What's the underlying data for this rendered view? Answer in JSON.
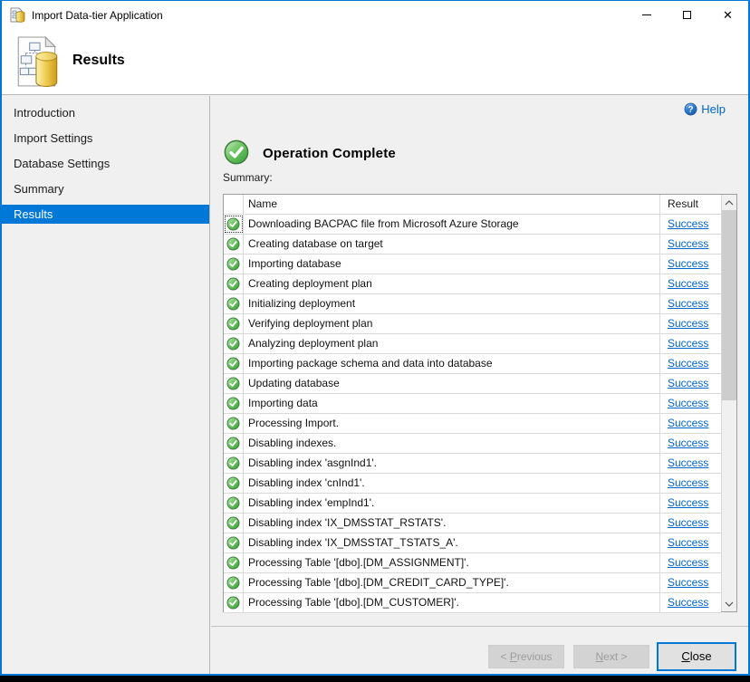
{
  "window": {
    "title": "Import Data-tier Application",
    "close_glyph": "✕"
  },
  "header": {
    "title": "Results"
  },
  "sidebar": {
    "selected_index": 4,
    "items": [
      {
        "label": "Introduction"
      },
      {
        "label": "Import Settings"
      },
      {
        "label": "Database Settings"
      },
      {
        "label": "Summary"
      },
      {
        "label": "Results"
      }
    ]
  },
  "content": {
    "help_label": "Help",
    "status_heading": "Operation Complete",
    "summary_label": "Summary:",
    "table": {
      "columns": {
        "name": "Name",
        "result": "Result"
      },
      "rows": [
        {
          "name": "Downloading BACPAC file from Microsoft Azure Storage",
          "result": "Success"
        },
        {
          "name": "Creating database on target",
          "result": "Success"
        },
        {
          "name": "Importing database",
          "result": "Success"
        },
        {
          "name": "Creating deployment plan",
          "result": "Success"
        },
        {
          "name": "Initializing deployment",
          "result": "Success"
        },
        {
          "name": "Verifying deployment plan",
          "result": "Success"
        },
        {
          "name": "Analyzing deployment plan",
          "result": "Success"
        },
        {
          "name": "Importing package schema and data into database",
          "result": "Success"
        },
        {
          "name": "Updating database",
          "result": "Success"
        },
        {
          "name": "Importing data",
          "result": "Success"
        },
        {
          "name": "Processing Import.",
          "result": "Success"
        },
        {
          "name": "Disabling indexes.",
          "result": "Success"
        },
        {
          "name": "Disabling index 'asgnInd1'.",
          "result": "Success"
        },
        {
          "name": "Disabling index 'cnInd1'.",
          "result": "Success"
        },
        {
          "name": "Disabling index 'empInd1'.",
          "result": "Success"
        },
        {
          "name": "Disabling index 'IX_DMSSTAT_RSTATS'.",
          "result": "Success"
        },
        {
          "name": "Disabling index 'IX_DMSSTAT_TSTATS_A'.",
          "result": "Success"
        },
        {
          "name": "Processing Table '[dbo].[DM_ASSIGNMENT]'.",
          "result": "Success"
        },
        {
          "name": "Processing Table '[dbo].[DM_CREDIT_CARD_TYPE]'.",
          "result": "Success"
        },
        {
          "name": "Processing Table '[dbo].[DM_CUSTOMER]'.",
          "result": "Success"
        }
      ]
    }
  },
  "footer": {
    "previous": {
      "pre": "< ",
      "key": "P",
      "rest": "revious"
    },
    "next": {
      "pre": "",
      "key": "N",
      "rest": "ext >"
    },
    "close": {
      "pre": "",
      "key": "C",
      "rest": "lose"
    }
  },
  "colors": {
    "accent": "#0078d7",
    "link_blue": "#0066cc",
    "success_green": "#4aa94a",
    "database_gold": "#e8c23a"
  }
}
